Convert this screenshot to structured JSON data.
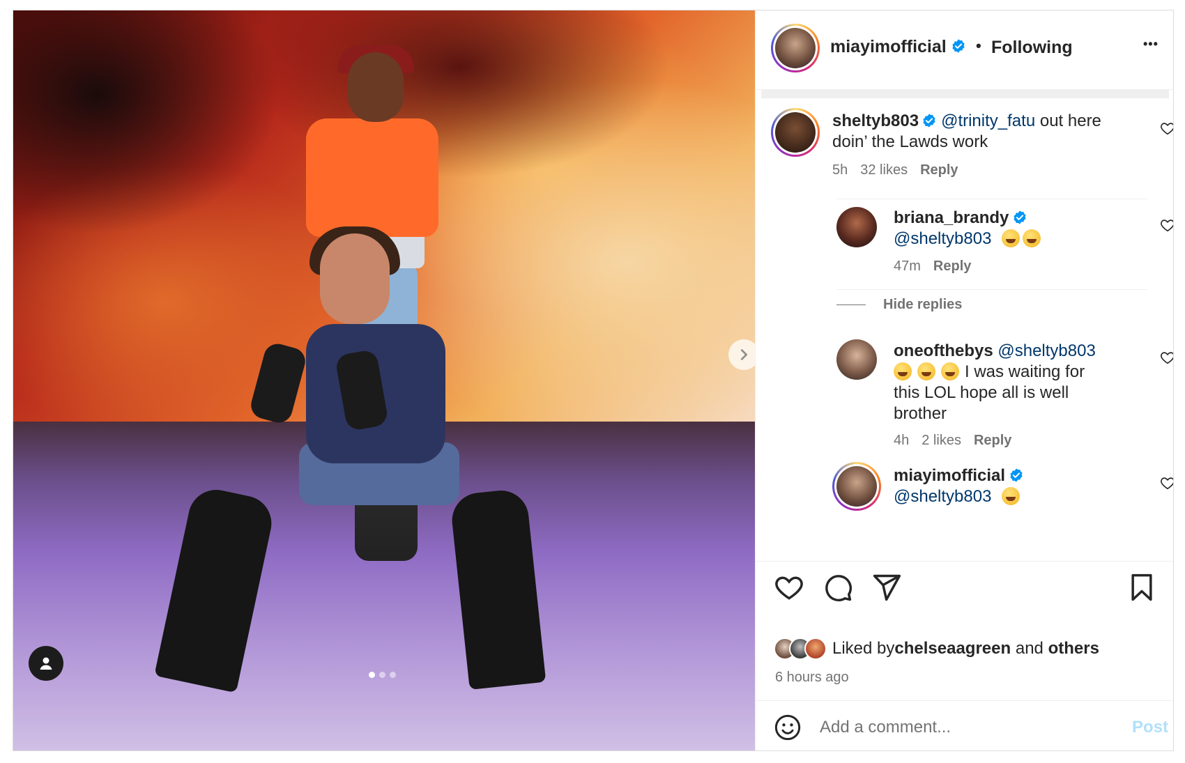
{
  "header": {
    "username": "miayimofficial",
    "separator": "•",
    "follow_status": "Following",
    "more_label": "•••"
  },
  "comments": [
    {
      "username": "sheltyb803",
      "mention": "@trinity_fatu",
      "text_line1": " out here",
      "text_line2": "doin’ the Lawds work",
      "time": "5h",
      "likes": "32 likes",
      "reply": "Reply"
    },
    {
      "username": "briana_brandy",
      "mention": "@sheltyb803",
      "time": "47m",
      "reply": "Reply"
    },
    {
      "username": "oneofthebys",
      "mention": "@sheltyb803",
      "text_line2": "I was waiting for",
      "text_line3": "this LOL hope all is well",
      "text_line4": "brother",
      "time": "4h",
      "likes": "2 likes",
      "reply": "Reply"
    },
    {
      "username": "miayimofficial",
      "mention": "@sheltyb803"
    }
  ],
  "hide_replies": "Hide replies",
  "liked_by": {
    "prefix": "Liked by ",
    "user": "chelseaagreen",
    "middle": " and ",
    "others": "others"
  },
  "time_ago": "6 hours ago",
  "comment_box": {
    "placeholder": "Add a comment...",
    "post_label": "Post"
  },
  "carousel": {
    "total_slides": 3,
    "active_slide": 1
  },
  "colors": {
    "verified": "#0095f6",
    "mention": "#00376b",
    "post_disabled": "#b2dffc"
  }
}
